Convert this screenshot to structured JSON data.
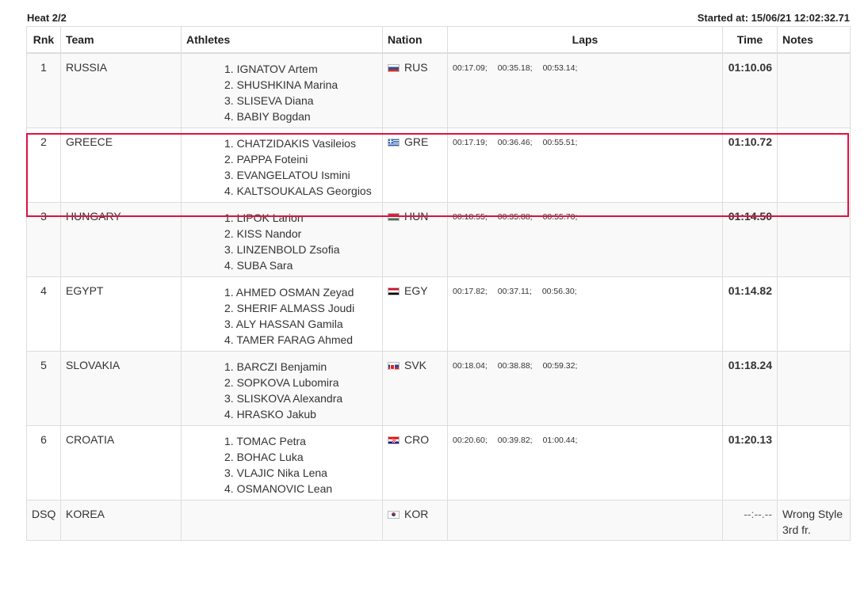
{
  "heat": {
    "title": "Heat 2/2",
    "started": "Started at: 15/06/21 12:02:32.71"
  },
  "columns": {
    "rank": "Rnk",
    "team": "Team",
    "athletes": "Athletes",
    "nation": "Nation",
    "laps": "Laps",
    "time": "Time",
    "notes": "Notes"
  },
  "rows": [
    {
      "rank": "1",
      "team": "RUSSIA",
      "athletes": [
        "1. IGNATOV Artem",
        "2. SHUSHKINA Marina",
        "3. SLISEVA Diana",
        "4. BABIY Bogdan"
      ],
      "nation": "RUS",
      "flag": "flag-rus",
      "laps": [
        "00:17.09;",
        "00:35.18;",
        "00:53.14;"
      ],
      "time": "01:10.06",
      "notes": []
    },
    {
      "rank": "2",
      "team": "GREECE",
      "athletes": [
        "1. CHATZIDAKIS Vasileios",
        "2. PAPPA Foteini",
        "3. EVANGELATOU Ismini",
        "4. KALTSOUKALAS Georgios"
      ],
      "nation": "GRE",
      "flag": "flag-gre",
      "laps": [
        "00:17.19;",
        "00:36.46;",
        "00:55.51;"
      ],
      "time": "01:10.72",
      "notes": []
    },
    {
      "rank": "3",
      "team": "HUNGARY",
      "athletes": [
        "1. LIPOK Larion",
        "2. KISS Nandor",
        "3. LINZENBOLD Zsofia",
        "4. SUBA Sara"
      ],
      "nation": "HUN",
      "flag": "flag-hun",
      "laps": [
        "00:18.55;",
        "00:35.88;",
        "00:55.70;"
      ],
      "time": "01:14.50",
      "notes": []
    },
    {
      "rank": "4",
      "team": "EGYPT",
      "athletes": [
        "1. AHMED OSMAN Zeyad",
        "2. SHERIF ALMASS Joudi",
        "3. ALY HASSAN Gamila",
        "4. TAMER FARAG Ahmed"
      ],
      "nation": "EGY",
      "flag": "flag-egy",
      "laps": [
        "00:17.82;",
        "00:37.11;",
        "00:56.30;"
      ],
      "time": "01:14.82",
      "notes": []
    },
    {
      "rank": "5",
      "team": "SLOVAKIA",
      "athletes": [
        "1. BARCZI Benjamin",
        "2. SOPKOVA Lubomira",
        "3. SLISKOVA Alexandra",
        "4. HRASKO Jakub"
      ],
      "nation": "SVK",
      "flag": "flag-svk",
      "laps": [
        "00:18.04;",
        "00:38.88;",
        "00:59.32;"
      ],
      "time": "01:18.24",
      "notes": []
    },
    {
      "rank": "6",
      "team": "CROATIA",
      "athletes": [
        "1. TOMAC Petra",
        "2. BOHAC Luka",
        "3. VLAJIC Nika Lena",
        "4. OSMANOVIC Lean"
      ],
      "nation": "CRO",
      "flag": "flag-cro",
      "laps": [
        "00:20.60;",
        "00:39.82;",
        "01:00.44;"
      ],
      "time": "01:20.13",
      "notes": []
    },
    {
      "rank": "DSQ",
      "team": "KOREA",
      "athletes": [],
      "nation": "KOR",
      "flag": "flag-kor",
      "laps": [],
      "time": "--:--.--",
      "notes": [
        "Wrong Style",
        "3rd fr."
      ]
    }
  ]
}
